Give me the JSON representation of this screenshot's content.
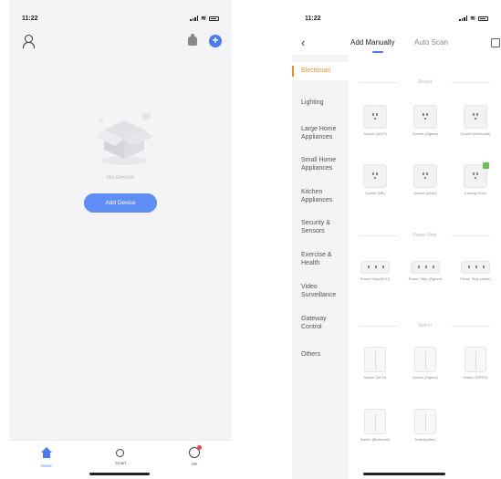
{
  "left_screen": {
    "status_time": "11:22",
    "empty_text": "No devices",
    "add_device_label": "Add Device",
    "tabs": [
      {
        "label": "Home",
        "icon": "home-icon",
        "active": true
      },
      {
        "label": "Smart",
        "icon": "sun-icon",
        "active": false
      },
      {
        "label": "Me",
        "icon": "me-icon",
        "active": false
      }
    ],
    "accent_color": "#4a7cf0"
  },
  "right_screen": {
    "status_time": "11:22",
    "tabs": {
      "manual": "Add Manually",
      "scan": "Auto Scan"
    },
    "categories": [
      {
        "label": "Electrician",
        "active": true
      },
      {
        "label": "Lighting"
      },
      {
        "label": "Large Home Appliances"
      },
      {
        "label": "Small Home Appliances"
      },
      {
        "label": "Kitchen Appliances"
      },
      {
        "label": "Security & Sensors"
      },
      {
        "label": "Exercise & Health"
      },
      {
        "label": "Video Surveillance"
      },
      {
        "label": "Gateway Control"
      },
      {
        "label": "Others"
      }
    ],
    "sections": {
      "socket": "Socket",
      "power_strip": "Power Strip",
      "switch": "Switch"
    },
    "socket_devices": [
      "Socket (Wi-Fi)",
      "Socket (Zigbee)",
      "Socket (Bluetooth)",
      "Socket (NB)",
      "Socket (other)",
      "Coming Soon"
    ],
    "strip_devices": [
      "Power Strip(Wi-Fi)",
      "Power Strip (Zigbee)",
      "Power Strip (other)"
    ],
    "switch_devices": [
      "Switch (Wi-Fi)",
      "Switch (Zigbee)",
      "Switch (GPRS)",
      "Switch (Bluetooth)",
      "Switch(other)"
    ],
    "highlight_color": "#f08a2c"
  }
}
